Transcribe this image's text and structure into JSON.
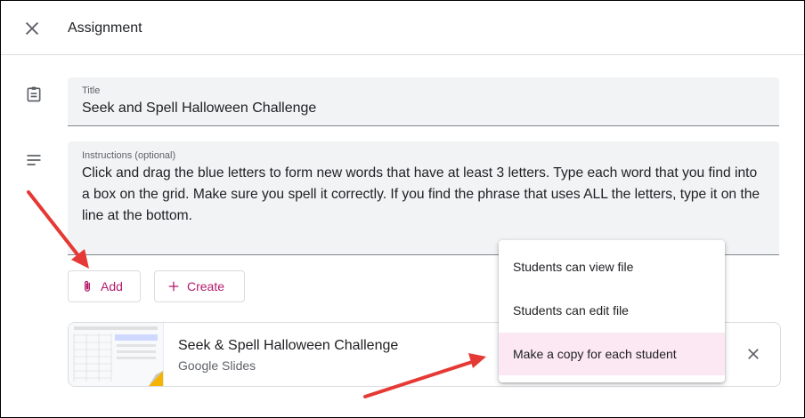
{
  "header": {
    "title": "Assignment"
  },
  "title_field": {
    "label": "Title",
    "value": "Seek and Spell Halloween Challenge"
  },
  "instructions_field": {
    "label": "Instructions (optional)",
    "value": "Click and drag the blue letters to form new words that have at least 3 letters. Type each word that you find into a box on the grid. Make sure you spell it correctly. If you find the phrase that uses ALL the letters, type it on the line at the bottom."
  },
  "buttons": {
    "add": "Add",
    "create": "Create"
  },
  "attachment": {
    "title": "Seek & Spell Halloween Challenge",
    "type": "Google Slides"
  },
  "share_menu": {
    "options": [
      "Students can view file",
      "Students can edit file",
      "Make a copy for each student"
    ],
    "selected": "Make a copy for each student"
  },
  "colors": {
    "accent": "#b31b6b",
    "selected_bg": "#fce8f2",
    "field_bg": "#f1f3f4",
    "annotation_arrow": "#e53935"
  },
  "icons": [
    "close-icon",
    "assignment-icon",
    "notes-icon",
    "attach-icon",
    "plus-icon",
    "close-attachment-icon"
  ]
}
